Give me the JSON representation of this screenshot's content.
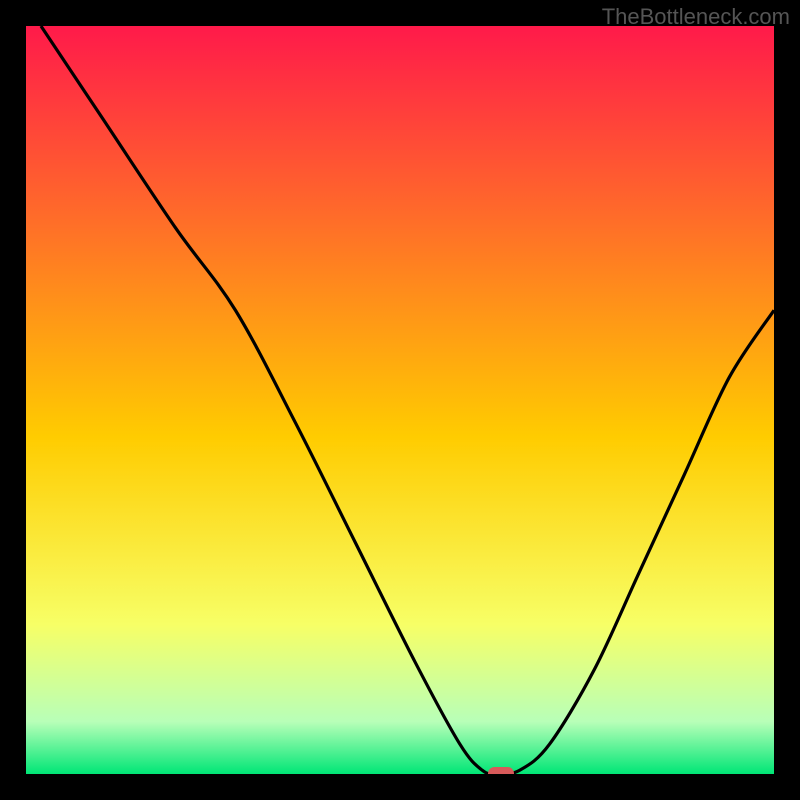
{
  "watermark": "TheBottleneck.com",
  "colors": {
    "background": "#000000",
    "gradient_top": "#ff1a4a",
    "gradient_upper_mid": "#ff6a2a",
    "gradient_mid": "#ffcc00",
    "gradient_lower_mid": "#f7ff66",
    "gradient_green_pale": "#b8ffb8",
    "gradient_bottom": "#00e676",
    "curve": "#000000",
    "marker": "#d85a5a"
  },
  "chart_data": {
    "type": "line",
    "title": "",
    "xlabel": "",
    "ylabel": "",
    "xlim": [
      0,
      100
    ],
    "ylim": [
      0,
      100
    ],
    "grid": false,
    "legend": false,
    "series": [
      {
        "name": "bottleneck-curve",
        "x": [
          2,
          10,
          20,
          28,
          36,
          44,
          52,
          58,
          61,
          63,
          66,
          70,
          76,
          82,
          88,
          94,
          100
        ],
        "y": [
          100,
          88,
          73,
          62,
          47,
          31,
          15,
          4,
          0.5,
          0,
          0.5,
          4,
          14,
          27,
          40,
          53,
          62
        ]
      }
    ],
    "marker": {
      "x": 63.5,
      "y": 0,
      "shape": "lozenge"
    },
    "gradient_stops": [
      {
        "offset": 0.0,
        "color": "#ff1a4a"
      },
      {
        "offset": 0.25,
        "color": "#ff6a2a"
      },
      {
        "offset": 0.55,
        "color": "#ffcc00"
      },
      {
        "offset": 0.8,
        "color": "#f7ff66"
      },
      {
        "offset": 0.93,
        "color": "#b8ffb8"
      },
      {
        "offset": 1.0,
        "color": "#00e676"
      }
    ]
  }
}
